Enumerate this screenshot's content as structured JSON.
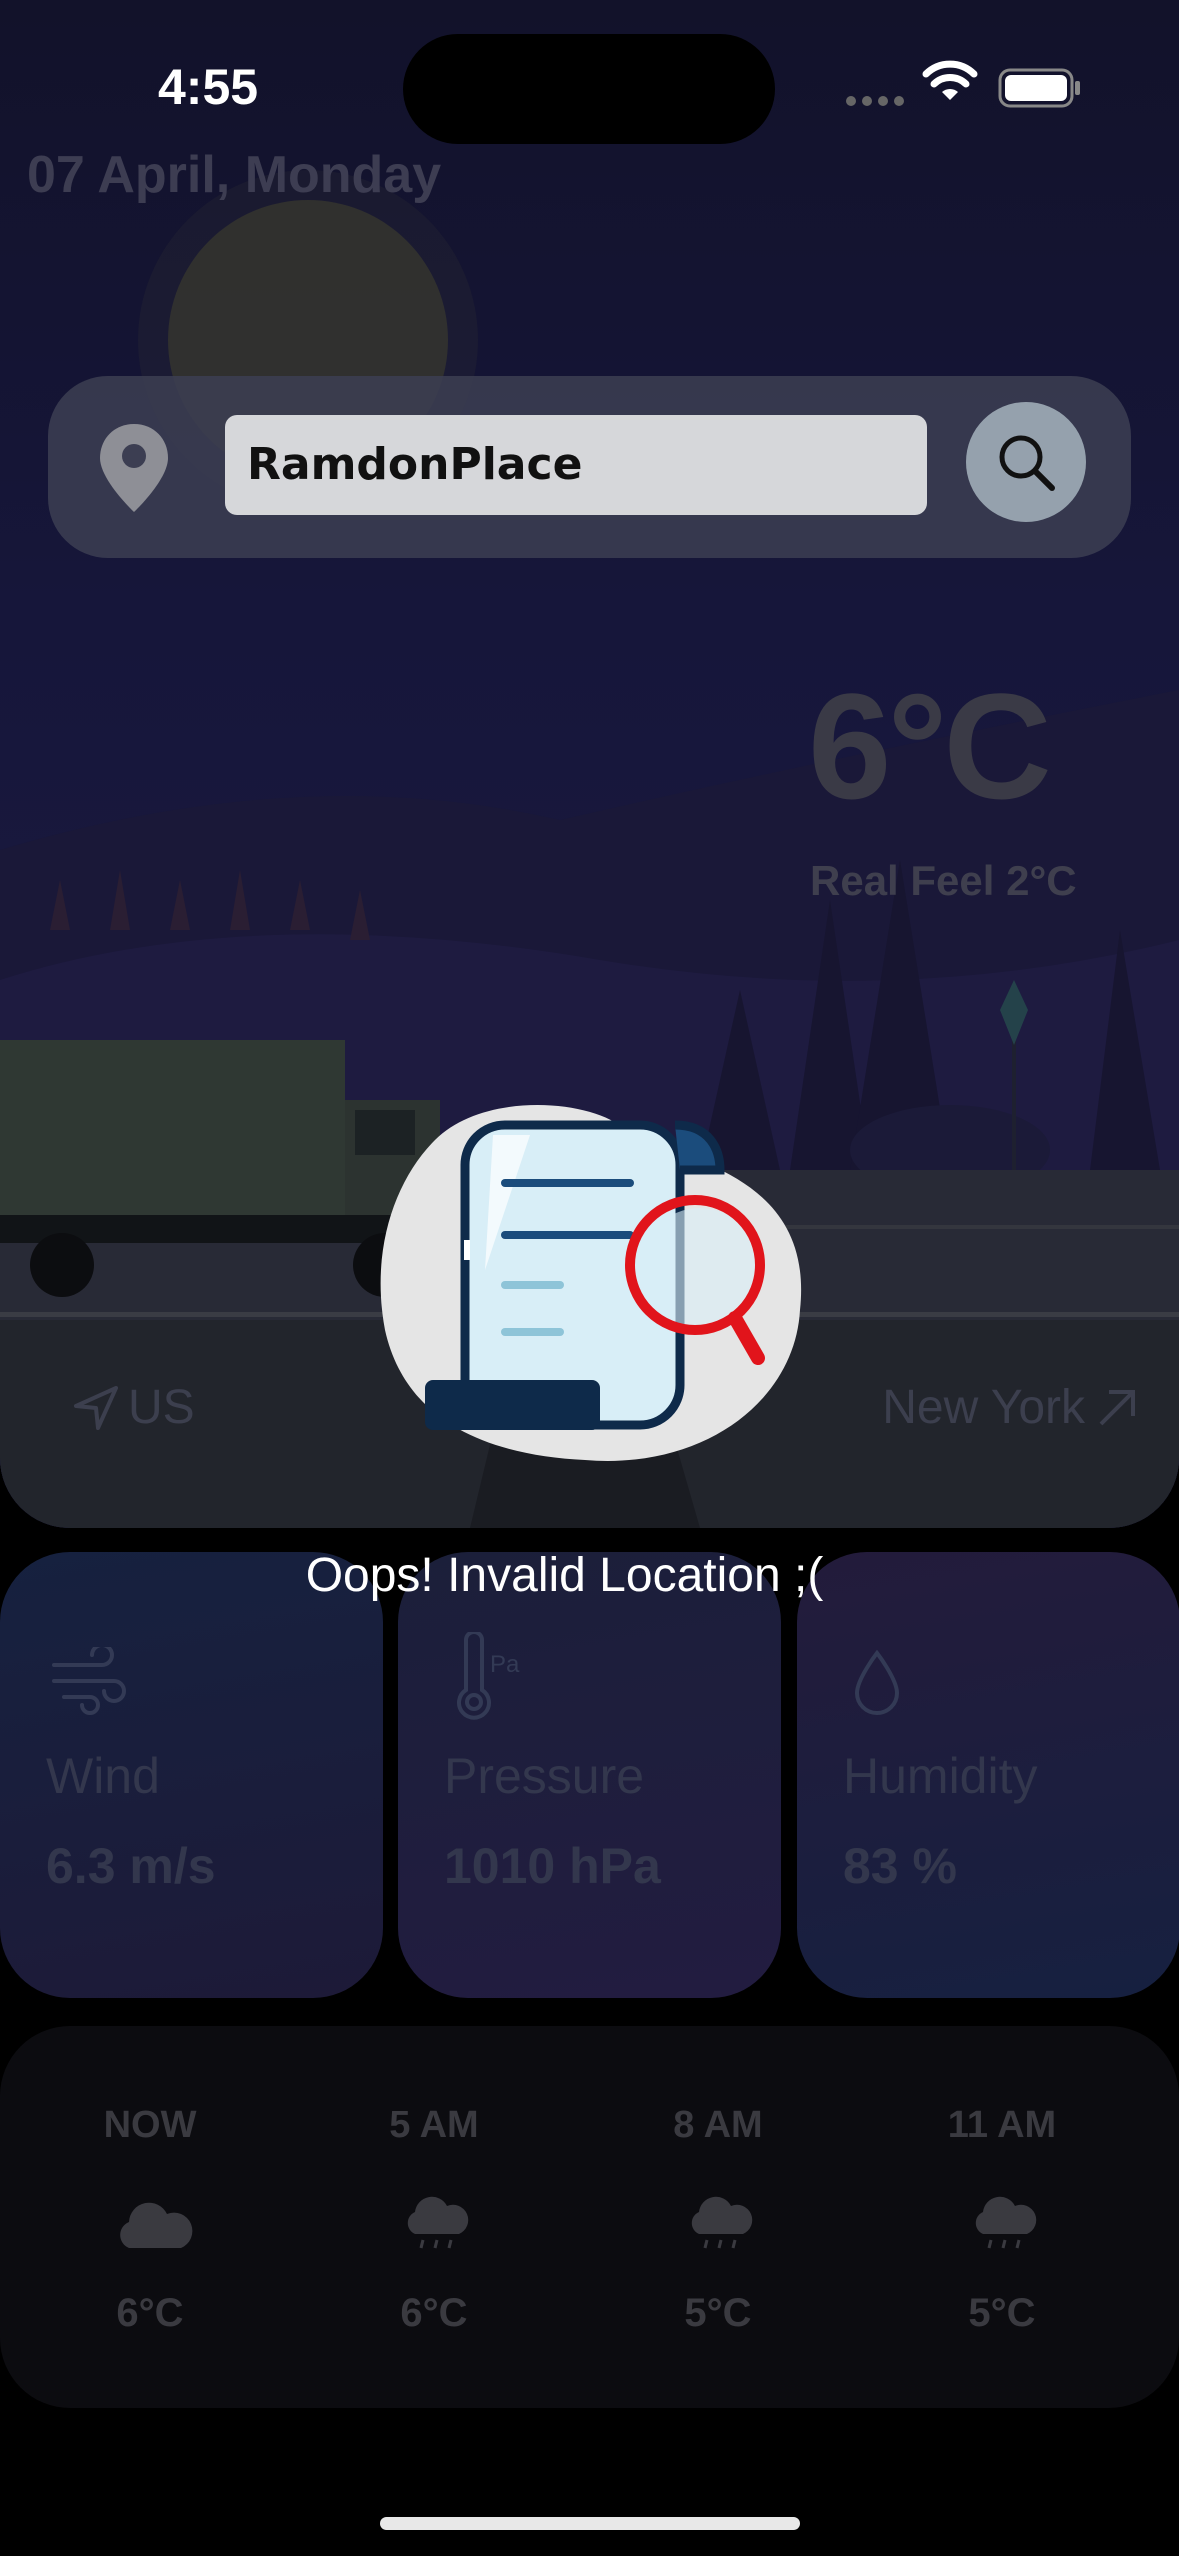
{
  "status_bar": {
    "time": "4:55"
  },
  "header": {
    "date": "07 April, Monday"
  },
  "search": {
    "value": "RamdonPlace",
    "icon": "search-icon",
    "pin_icon": "location-pin-icon"
  },
  "current": {
    "temperature": "6°C",
    "real_feel": "Real Feel 2°C",
    "country": "US",
    "city": "New York"
  },
  "error": {
    "message": "Oops! Invalid Location ;(",
    "icon": "document-search-icon"
  },
  "stats": [
    {
      "label": "Wind",
      "value": "6.3 m/s",
      "icon": "wind-icon"
    },
    {
      "label": "Pressure",
      "value": "1010 hPa",
      "icon": "thermometer-pressure-icon"
    },
    {
      "label": "Humidity",
      "value": "83 %",
      "icon": "droplet-icon"
    }
  ],
  "forecast": [
    {
      "time": "NOW",
      "temp": "6°C",
      "icon": "cloud-icon"
    },
    {
      "time": "5 AM",
      "temp": "6°C",
      "icon": "cloud-rain-icon"
    },
    {
      "time": "8 AM",
      "temp": "5°C",
      "icon": "cloud-rain-icon"
    },
    {
      "time": "11 AM",
      "temp": "5°C",
      "icon": "cloud-rain-icon"
    }
  ],
  "colors": {
    "error_text": "#ffffff",
    "search_button": "#95a1ad",
    "search_field": "#d6d7da"
  }
}
